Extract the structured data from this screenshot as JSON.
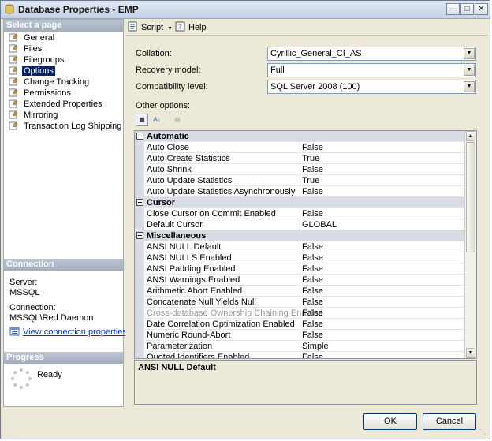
{
  "window": {
    "title": "Database Properties - EMP"
  },
  "left": {
    "select_page": "Select a page",
    "pages": [
      {
        "label": "General"
      },
      {
        "label": "Files"
      },
      {
        "label": "Filegroups"
      },
      {
        "label": "Options"
      },
      {
        "label": "Change Tracking"
      },
      {
        "label": "Permissions"
      },
      {
        "label": "Extended Properties"
      },
      {
        "label": "Mirroring"
      },
      {
        "label": "Transaction Log Shipping"
      }
    ],
    "selected_page": "Options",
    "connection_header": "Connection",
    "server_label": "Server:",
    "server_value": "MSSQL",
    "connection_label": "Connection:",
    "connection_value": "MSSQL\\Red Daemon",
    "view_link": "View connection properties",
    "progress_header": "Progress",
    "progress_status": "Ready"
  },
  "toolbar": {
    "script": "Script",
    "help": "Help"
  },
  "form": {
    "collation_label": "Collation:",
    "collation_value": "Cyrillic_General_CI_AS",
    "recovery_label": "Recovery model:",
    "recovery_value": "Full",
    "compat_label": "Compatibility level:",
    "compat_value": "SQL Server 2008 (100)",
    "other_label": "Other options:"
  },
  "grid": {
    "rows": [
      {
        "category": "Automatic"
      },
      {
        "name": "Auto Close",
        "value": "False"
      },
      {
        "name": "Auto Create Statistics",
        "value": "True"
      },
      {
        "name": "Auto Shrink",
        "value": "False"
      },
      {
        "name": "Auto Update Statistics",
        "value": "True"
      },
      {
        "name": "Auto Update Statistics Asynchronously",
        "value": "False"
      },
      {
        "category": "Cursor"
      },
      {
        "name": "Close Cursor on Commit Enabled",
        "value": "False"
      },
      {
        "name": "Default Cursor",
        "value": "GLOBAL"
      },
      {
        "category": "Miscellaneous"
      },
      {
        "name": "ANSI NULL Default",
        "value": "False"
      },
      {
        "name": "ANSI NULLS Enabled",
        "value": "False"
      },
      {
        "name": "ANSI Padding Enabled",
        "value": "False"
      },
      {
        "name": "ANSI Warnings Enabled",
        "value": "False"
      },
      {
        "name": "Arithmetic Abort Enabled",
        "value": "False"
      },
      {
        "name": "Concatenate Null Yields Null",
        "value": "False"
      },
      {
        "name": "Cross-database Ownership Chaining Enabled",
        "value": "False",
        "disabled": true
      },
      {
        "name": "Date Correlation Optimization Enabled",
        "value": "False"
      },
      {
        "name": "Numeric Round-Abort",
        "value": "False"
      },
      {
        "name": "Parameterization",
        "value": "Simple"
      },
      {
        "name": "Quoted Identifiers Enabled",
        "value": "False"
      }
    ],
    "description_title": "ANSI NULL Default"
  },
  "buttons": {
    "ok": "OK",
    "cancel": "Cancel"
  },
  "colors": {
    "selection": "#0a246a",
    "header": "#a3aebd",
    "link": "#0033cc"
  }
}
